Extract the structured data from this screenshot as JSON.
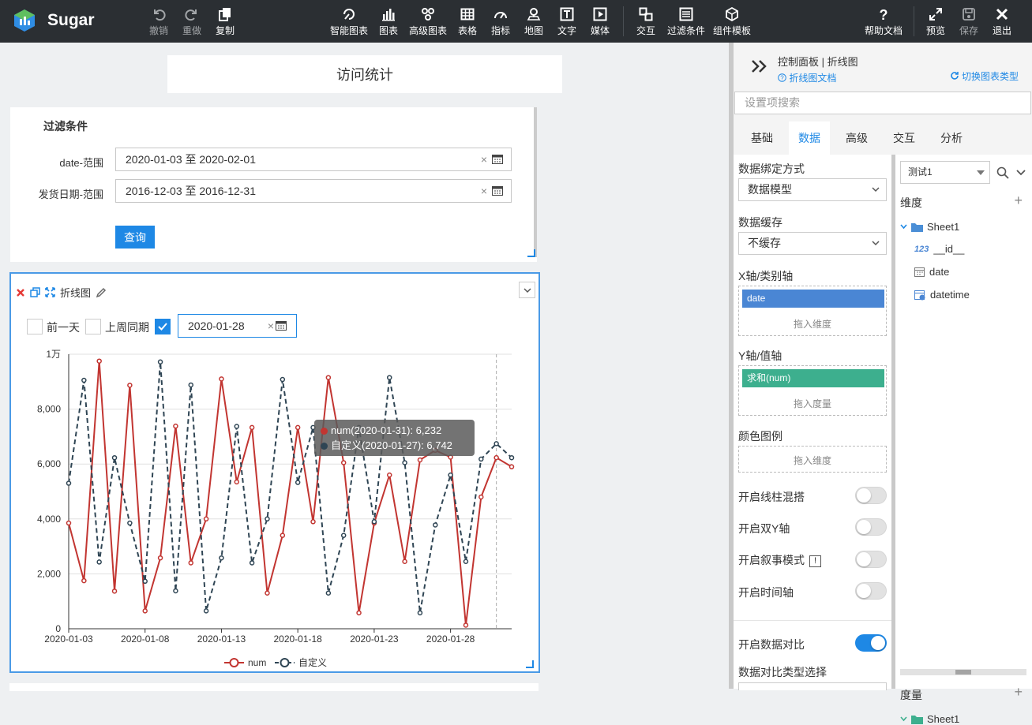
{
  "app": {
    "brand": "Sugar"
  },
  "toolbar": {
    "undo": "撤销",
    "redo": "重做",
    "copy": "复制",
    "smart_chart": "智能图表",
    "chart": "图表",
    "adv_chart": "高级图表",
    "table": "表格",
    "indicator": "指标",
    "map": "地图",
    "text": "文字",
    "media": "媒体",
    "interact": "交互",
    "filter": "过滤条件",
    "template": "组件模板",
    "help": "帮助文档",
    "preview": "预览",
    "save": "保存",
    "exit": "退出"
  },
  "canvas": {
    "title": "访问统计",
    "filter": {
      "title": "过滤条件",
      "rows": [
        {
          "label": "date-范围",
          "value": "2020-01-03 至 2020-02-01"
        },
        {
          "label": "发货日期-范围",
          "value": "2016-12-03 至 2016-12-31"
        }
      ],
      "query_label": "查询",
      "clear": "×"
    },
    "chart_widget": {
      "name": "折线图",
      "options": [
        {
          "label": "前一天",
          "checked": false
        },
        {
          "label": "上周同期",
          "checked": false
        }
      ],
      "compare_date": "2020-01-28",
      "clear": "×"
    }
  },
  "chart_data": {
    "type": "line",
    "x": [
      "2020-01-03",
      "2020-01-04",
      "2020-01-05",
      "2020-01-06",
      "2020-01-07",
      "2020-01-08",
      "2020-01-09",
      "2020-01-10",
      "2020-01-11",
      "2020-01-12",
      "2020-01-13",
      "2020-01-14",
      "2020-01-15",
      "2020-01-16",
      "2020-01-17",
      "2020-01-18",
      "2020-01-19",
      "2020-01-20",
      "2020-01-21",
      "2020-01-22",
      "2020-01-23",
      "2020-01-24",
      "2020-01-25",
      "2020-01-26",
      "2020-01-27",
      "2020-01-28",
      "2020-01-29",
      "2020-01-30",
      "2020-01-31",
      "2020-02-01"
    ],
    "x_ticks": [
      "2020-01-03",
      "2020-01-08",
      "2020-01-13",
      "2020-01-18",
      "2020-01-23",
      "2020-01-28"
    ],
    "y_ticks": [
      "0",
      "2,000",
      "4,000",
      "6,000",
      "8,000",
      "1万"
    ],
    "ylim": [
      0,
      10000
    ],
    "series": [
      {
        "name": "num",
        "color": "#c23531",
        "dashed": false,
        "values": [
          3850,
          1750,
          9750,
          1370,
          8870,
          650,
          2580,
          7380,
          2400,
          4000,
          9100,
          5350,
          7330,
          1300,
          3400,
          7330,
          3900,
          9150,
          6050,
          580,
          3850,
          5600,
          2450,
          6150,
          6500,
          6250,
          130,
          4800,
          6232,
          5900
        ]
      },
      {
        "name": "自定义",
        "color": "#2f4554",
        "dashed": true,
        "values": [
          5300,
          9050,
          2430,
          6230,
          3850,
          1730,
          9720,
          1380,
          8880,
          650,
          2580,
          7370,
          2400,
          4000,
          9080,
          5330,
          7330,
          1300,
          3400,
          7330,
          3900,
          9150,
          6050,
          580,
          3780,
          5600,
          2450,
          6180,
          6742,
          6230
        ]
      }
    ],
    "tooltip": {
      "line1": "num(2020-01-31): 6,232",
      "line2": "自定义(2020-01-27): 6,742"
    },
    "legend": [
      "num",
      "自定义"
    ]
  },
  "panel": {
    "title": "控制面板 | 折线图",
    "doc_link": "折线图文档",
    "switch_type": "切换图表类型",
    "search_placeholder": "设置项搜索",
    "tabs": [
      "基础",
      "数据",
      "高级",
      "交互",
      "分析"
    ],
    "active_tab": "数据",
    "binding_label": "数据绑定方式",
    "binding_value": "数据模型",
    "cache_label": "数据缓存",
    "cache_value": "不缓存",
    "x_axis_label": "X轴/类别轴",
    "x_chip": "date",
    "drop_dim": "拖入维度",
    "y_axis_label": "Y轴/值轴",
    "y_chip": "求和(num)",
    "drop_measure": "拖入度量",
    "color_label": "颜色图例",
    "toggles": [
      {
        "label": "开启线柱混搭",
        "on": false
      },
      {
        "label": "开启双Y轴",
        "on": false
      },
      {
        "label": "开启叙事模式",
        "on": false
      },
      {
        "label": "开启时间轴",
        "on": false
      }
    ],
    "compare_label": "开启数据对比",
    "compare_on": true,
    "compare_type_label": "数据对比类型选择",
    "model_select": "测试1",
    "dim_title": "维度",
    "sheet": "Sheet1",
    "fields": [
      {
        "icon": "123",
        "name": "__id__"
      },
      {
        "icon": "cal",
        "name": "date"
      },
      {
        "icon": "calclock",
        "name": "datetime"
      }
    ],
    "measure_title": "度量",
    "measure_sheet": "Sheet1",
    "colors": {
      "accent": "#1e88e5",
      "x_chip": "#4a86d4",
      "y_chip": "#3daf8e"
    }
  }
}
